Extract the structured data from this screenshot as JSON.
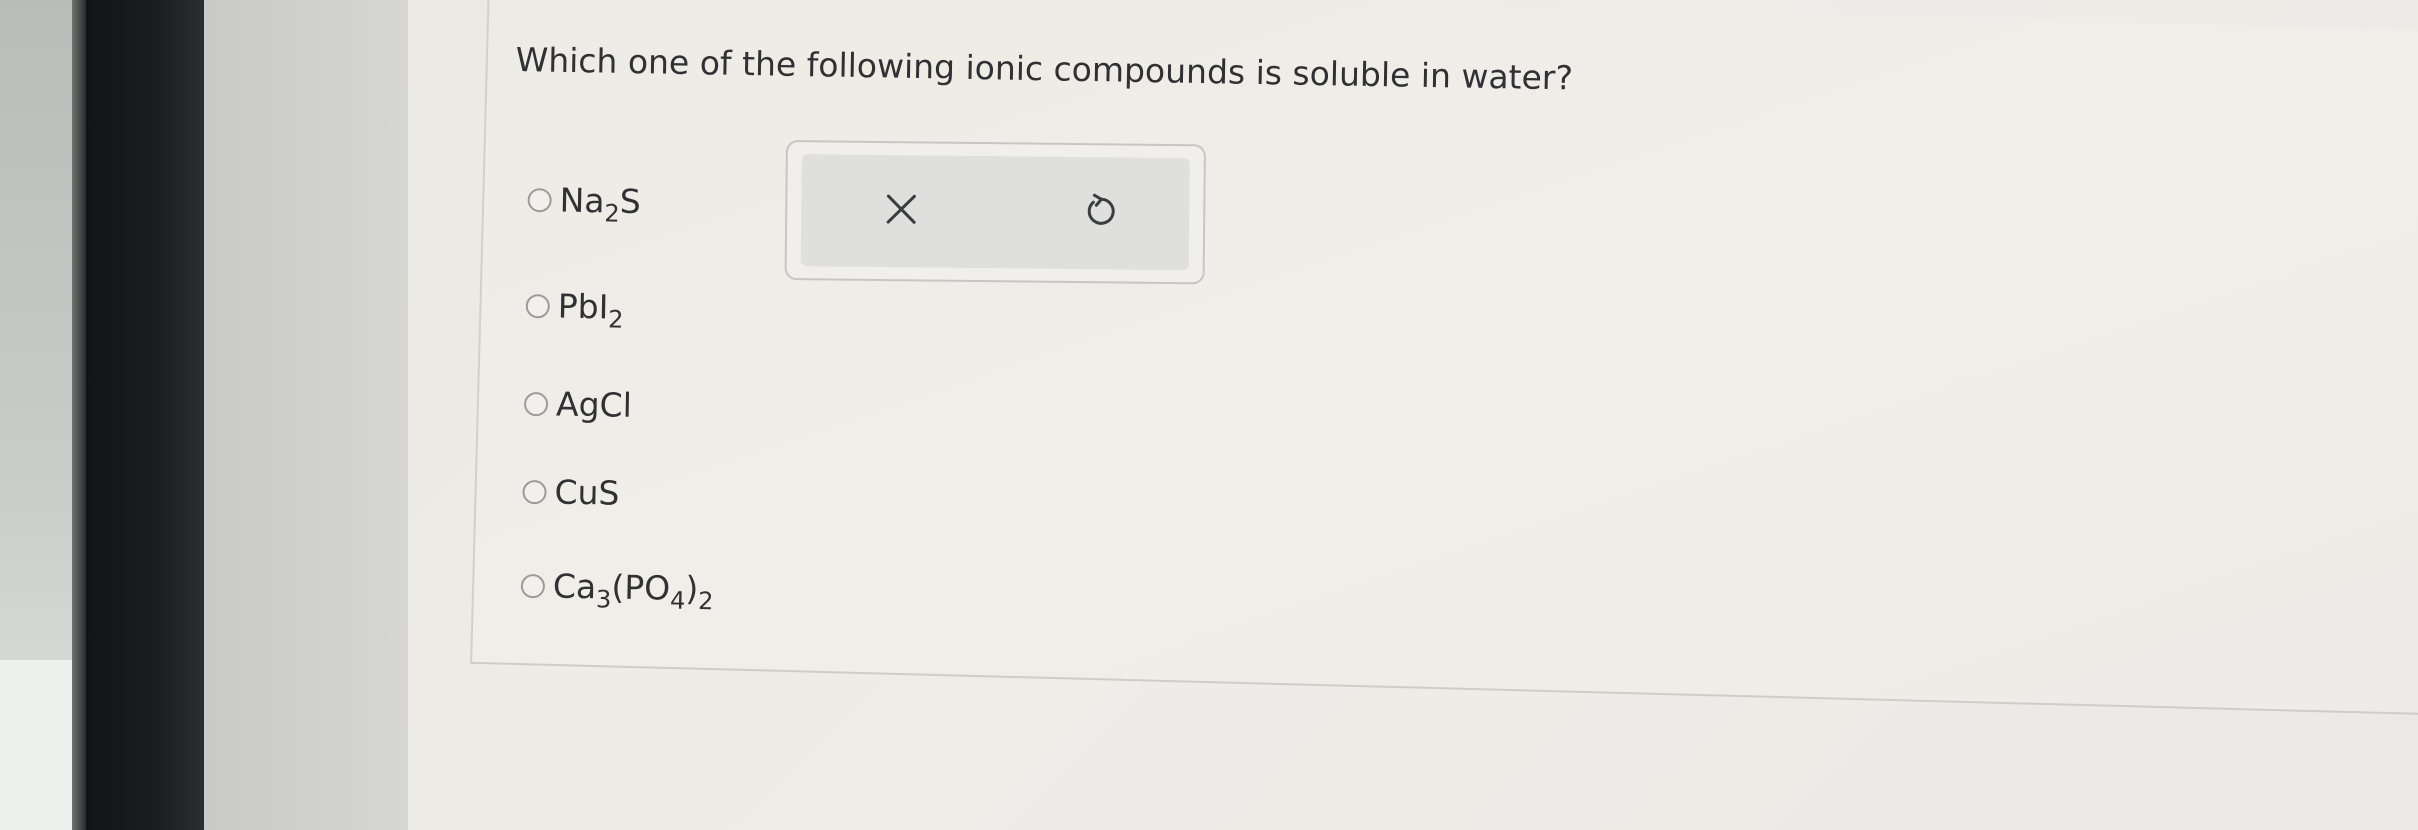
{
  "question": {
    "text": "Which one of the following ionic compounds is soluble in water?"
  },
  "options": [
    {
      "parts": [
        {
          "t": "Na"
        },
        {
          "t": "2",
          "sub": true
        },
        {
          "t": "S"
        }
      ],
      "selected": false
    },
    {
      "parts": [
        {
          "t": "PbI"
        },
        {
          "t": "2",
          "sub": true
        }
      ],
      "selected": false
    },
    {
      "parts": [
        {
          "t": "AgCl"
        }
      ],
      "selected": false
    },
    {
      "parts": [
        {
          "t": "CuS"
        }
      ],
      "selected": false
    },
    {
      "parts": [
        {
          "t": "Ca"
        },
        {
          "t": "3",
          "sub": true
        },
        {
          "t": "(PO"
        },
        {
          "t": "4",
          "sub": true
        },
        {
          "t": ")"
        },
        {
          "t": "2",
          "sub": true
        }
      ],
      "selected": false
    }
  ],
  "toolbar": {
    "clear_icon": "close-icon",
    "undo_icon": "undo-icon"
  },
  "colors": {
    "text": "#2f3134",
    "radio_border": "#9b9b9a",
    "toolbar_bg": "#dfdfdd"
  }
}
